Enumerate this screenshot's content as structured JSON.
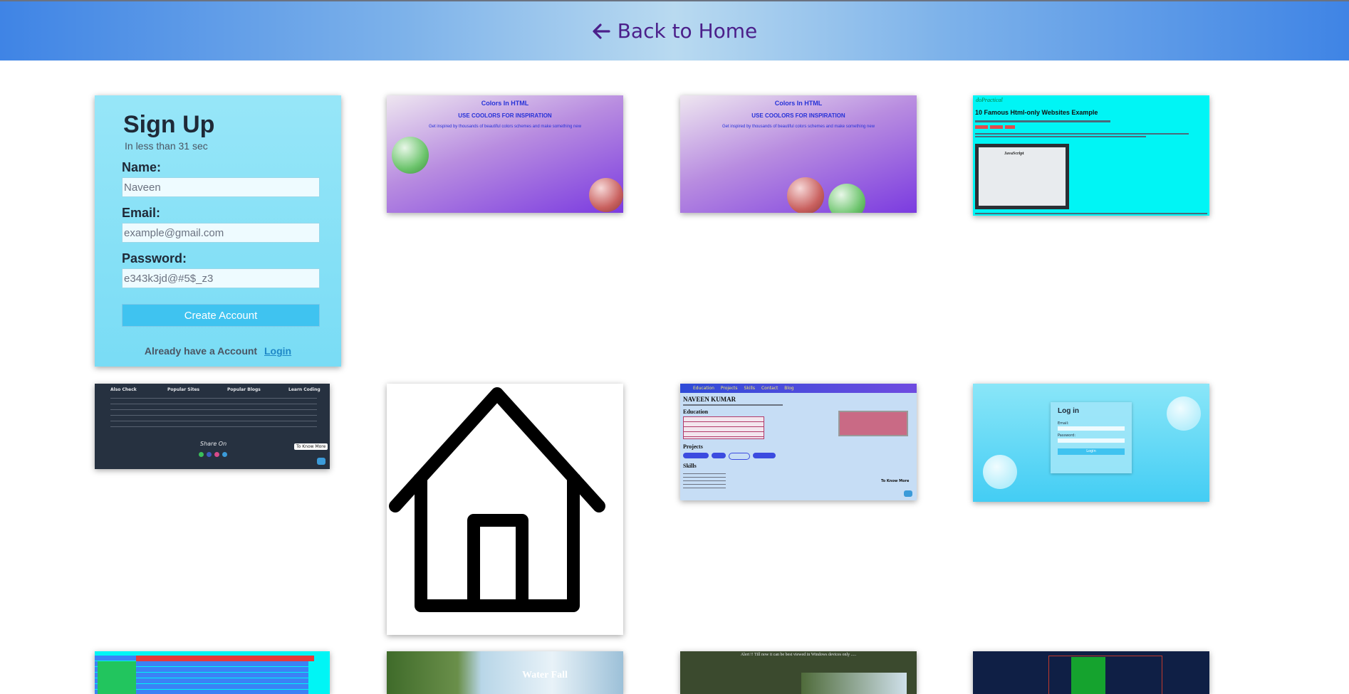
{
  "header": {
    "back_label": "Back to Home",
    "arrow": "arrow-left-icon"
  },
  "signup": {
    "title": "Sign Up",
    "subtitle": "In less than 31 sec",
    "name_label": "Name:",
    "name_placeholder": "Naveen",
    "email_label": "Email:",
    "email_placeholder": "example@gmail.com",
    "password_label": "Password:",
    "password_placeholder": "e343k3jd@#5$_z3",
    "create_button": "Create Account",
    "already_text": "Already have a Account",
    "login_link": "Login"
  },
  "colors_card": {
    "title": "Colors In HTML",
    "subtitle": "USE COOLORS FOR INSPIRATION",
    "line": "Get inspired by thousands of beautiful colors schemes and make something new"
  },
  "famous_card": {
    "brand": "doPractical",
    "title": "10 Famous Html-only Websites Example",
    "caption": "JavaScript"
  },
  "footer_card": {
    "columns": [
      "Also Check",
      "Popular Sites",
      "Popular Blogs",
      "Learn Coding"
    ],
    "share": "Share On",
    "know_more": "To Know More"
  },
  "portfolio_card": {
    "nav": [
      "Education",
      "Projects",
      "Skills",
      "Contact",
      "Blog"
    ],
    "name": "NAVEEN KUMAR",
    "sections": [
      "Education",
      "Projects",
      "Skills"
    ],
    "know_more": "To Know More"
  },
  "login_card": {
    "title": "Log in",
    "email": "Email:",
    "password": "Password:",
    "button": "Login"
  },
  "bottom_row": {
    "waterfall": "Water Fall",
    "alert": "Alert !! Till now it can be best viewed in Windows devices only ....."
  }
}
